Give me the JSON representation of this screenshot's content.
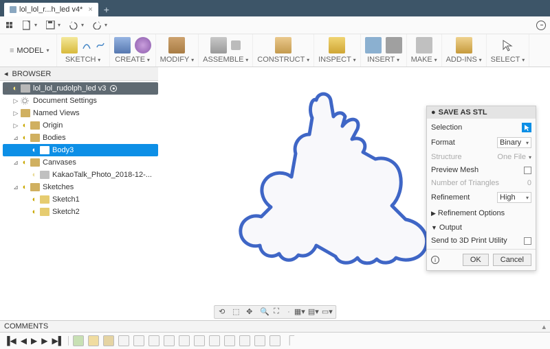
{
  "tab": {
    "title": "lol_lol_r...h_led v4*",
    "close": "×"
  },
  "ribbon": {
    "model": "MODEL",
    "groups": [
      {
        "label": "SKETCH",
        "icons": [
          "sketch-icon",
          "arc-icon",
          "spline-icon"
        ],
        "drop": true
      },
      {
        "label": "CREATE",
        "icons": [
          "box-icon",
          "sphere-icon"
        ],
        "drop": true
      },
      {
        "label": "MODIFY",
        "icons": [
          "pressbutton-icon"
        ],
        "drop": true
      },
      {
        "label": "ASSEMBLE",
        "icons": [
          "joint-icon",
          "rigid-icon"
        ],
        "drop": true
      },
      {
        "label": "CONSTRUCT",
        "icons": [
          "axis-icon"
        ],
        "drop": true
      },
      {
        "label": "INSPECT",
        "icons": [
          "measure-icon"
        ],
        "drop": true
      },
      {
        "label": "INSERT",
        "icons": [
          "decal-icon",
          "canvas-icon"
        ],
        "drop": true
      },
      {
        "label": "MAKE",
        "icons": [
          "print-icon"
        ],
        "drop": true
      },
      {
        "label": "ADD-INS",
        "icons": [
          "addins-icon"
        ],
        "drop": true
      },
      {
        "label": "SELECT",
        "icons": [
          "select-icon"
        ],
        "drop": true
      }
    ]
  },
  "browser": {
    "title": "BROWSER",
    "root": "lol_lol_rudolph_led v3",
    "items": {
      "docset": "Document Settings",
      "named": "Named Views",
      "origin": "Origin",
      "bodies": "Bodies",
      "body3": "Body3",
      "canvases": "Canvases",
      "canvas_name": "KakaoTalk_Photo_2018-12-...",
      "sketches": "Sketches",
      "sketch1": "Sketch1",
      "sketch2": "Sketch2"
    }
  },
  "dialog": {
    "title": "SAVE AS STL",
    "rows": {
      "selection": "Selection",
      "format": "Format",
      "format_value": "Binary",
      "structure": "Structure",
      "structure_value": "One File",
      "preview": "Preview Mesh",
      "triangles": "Number of Triangles",
      "triangles_value": "0",
      "refinement": "Refinement",
      "refinement_value": "High",
      "ref_opts": "Refinement Options",
      "output": "Output",
      "send": "Send to 3D Print Utility"
    },
    "ok": "OK",
    "cancel": "Cancel"
  },
  "comments": {
    "label": "COMMENTS"
  }
}
